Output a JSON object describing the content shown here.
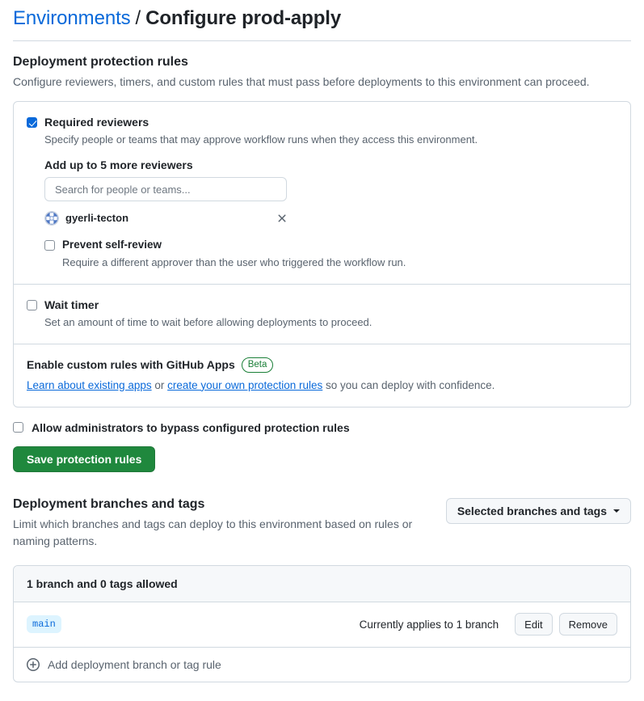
{
  "breadcrumb": {
    "parent": "Environments",
    "separator": "/",
    "current": "Configure prod-apply"
  },
  "protection": {
    "title": "Deployment protection rules",
    "description": "Configure reviewers, timers, and custom rules that must pass before deployments to this environment can proceed.",
    "required_reviewers": {
      "label": "Required reviewers",
      "description": "Specify people or teams that may approve workflow runs when they access this environment.",
      "checked": true,
      "add_label": "Add up to 5 more reviewers",
      "search_placeholder": "Search for people or teams...",
      "search_value": "",
      "reviewers": [
        {
          "name": "gyerli-tecton"
        }
      ]
    },
    "prevent_self_review": {
      "label": "Prevent self-review",
      "description": "Require a different approver than the user who triggered the workflow run.",
      "checked": false
    },
    "wait_timer": {
      "label": "Wait timer",
      "description": "Set an amount of time to wait before allowing deployments to proceed.",
      "checked": false
    },
    "custom_rules": {
      "title": "Enable custom rules with GitHub Apps",
      "badge": "Beta",
      "link_existing": "Learn about existing apps",
      "mid_text": " or ",
      "link_create": "create your own protection rules",
      "tail_text": " so you can deploy with confidence."
    },
    "admin_bypass": {
      "label": "Allow administrators to bypass configured protection rules",
      "checked": false
    },
    "save_label": "Save protection rules"
  },
  "branches": {
    "title": "Deployment branches and tags",
    "description": "Limit which branches and tags can deploy to this environment based on rules or naming patterns.",
    "dropdown_label": "Selected branches and tags",
    "rules_header": "1 branch and 0 tags allowed",
    "rules": [
      {
        "pattern": "main",
        "applies": "Currently applies to 1 branch",
        "edit_label": "Edit",
        "remove_label": "Remove"
      }
    ],
    "add_label": "Add deployment branch or tag rule"
  },
  "colors": {
    "link": "#0969da",
    "accent_checkbox": "#0969da",
    "success_button": "#1f883d",
    "beta_green": "#1a7f37",
    "border": "#d1d9e0",
    "muted_text": "#59636e",
    "chip_bg": "#ddf4ff"
  }
}
